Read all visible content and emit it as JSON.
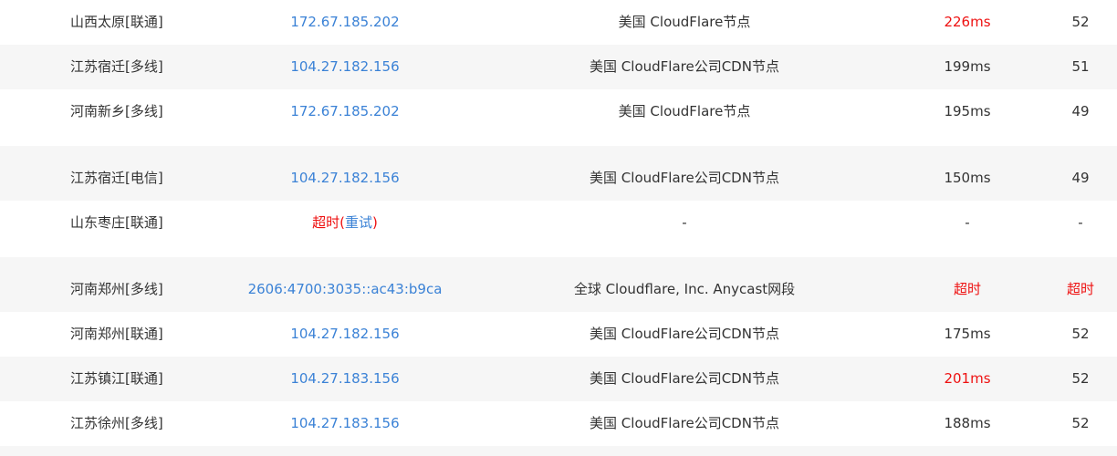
{
  "rows": [
    {
      "location": "山西太原[联通]",
      "ip": "172.67.185.202",
      "geo": "美国 CloudFlare节点",
      "latency": "226ms",
      "ttl": "52"
    },
    {
      "location": "江苏宿迁[多线]",
      "ip": "104.27.182.156",
      "geo": "美国 CloudFlare公司CDN节点",
      "latency": "199ms",
      "ttl": "51"
    },
    {
      "location": "河南新乡[多线]",
      "ip": "172.67.185.202",
      "geo": "美国 CloudFlare节点",
      "latency": "195ms",
      "ttl": "49"
    },
    {
      "location": "江苏宿迁[电信]",
      "ip": "104.27.182.156",
      "geo": "美国 CloudFlare公司CDN节点",
      "latency": "150ms",
      "ttl": "49"
    },
    {
      "location": "山东枣庄[联通]",
      "ip_timeout": "超时",
      "ip_retry_open": "(",
      "ip_retry": "重试",
      "ip_retry_close": ")",
      "geo": "-",
      "latency": "-",
      "ttl": "-"
    },
    {
      "location": "河南郑州[多线]",
      "ip": "2606:4700:3035::ac43:b9ca",
      "geo": "全球 Cloudflare, Inc. Anycast网段",
      "latency": "超时",
      "ttl": "超时"
    },
    {
      "location": "河南郑州[联通]",
      "ip": "104.27.182.156",
      "geo": "美国 CloudFlare公司CDN节点",
      "latency": "175ms",
      "ttl": "52"
    },
    {
      "location": "江苏镇江[联通]",
      "ip": "104.27.183.156",
      "geo": "美国 CloudFlare公司CDN节点",
      "latency": "201ms",
      "ttl": "52"
    },
    {
      "location": "江苏徐州[多线]",
      "ip": "104.27.183.156",
      "geo": "美国 CloudFlare公司CDN节点",
      "latency": "188ms",
      "ttl": "52"
    }
  ],
  "colors": {
    "link": "#3b82d6",
    "warning": "#ee1111",
    "stripe": "#f6f6f6",
    "text": "#333333"
  }
}
